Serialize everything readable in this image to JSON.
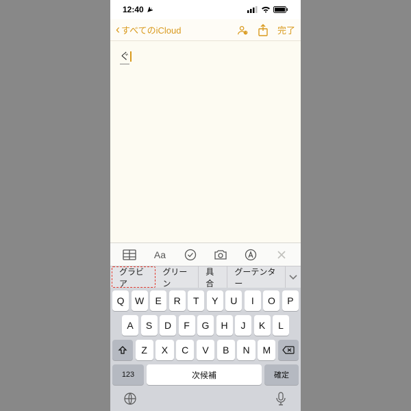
{
  "status": {
    "time": "12:40",
    "location_icon": "▸",
    "signal": "••ıl",
    "wifi": "⦿",
    "battery": "■"
  },
  "nav": {
    "back_chevron": "‹",
    "back_label": "すべてのiCloud",
    "done": "完了"
  },
  "note": {
    "content": "ぐ"
  },
  "toolbar": {
    "table": "grid",
    "format": "Aa",
    "check": "✓",
    "camera": "cam",
    "markup": "Ⓐ"
  },
  "suggestions": {
    "items": [
      "グラビア",
      "グリーン",
      "具合",
      "グーテンター"
    ],
    "highlighted_index": 0
  },
  "keyboard": {
    "row1": [
      "Q",
      "W",
      "E",
      "R",
      "T",
      "Y",
      "U",
      "I",
      "O",
      "P"
    ],
    "row2": [
      "A",
      "S",
      "D",
      "F",
      "G",
      "H",
      "J",
      "K",
      "L"
    ],
    "row3": [
      "Z",
      "X",
      "C",
      "V",
      "B",
      "N",
      "M"
    ],
    "mode_key": "123",
    "space": "次候補",
    "confirm": "確定"
  }
}
